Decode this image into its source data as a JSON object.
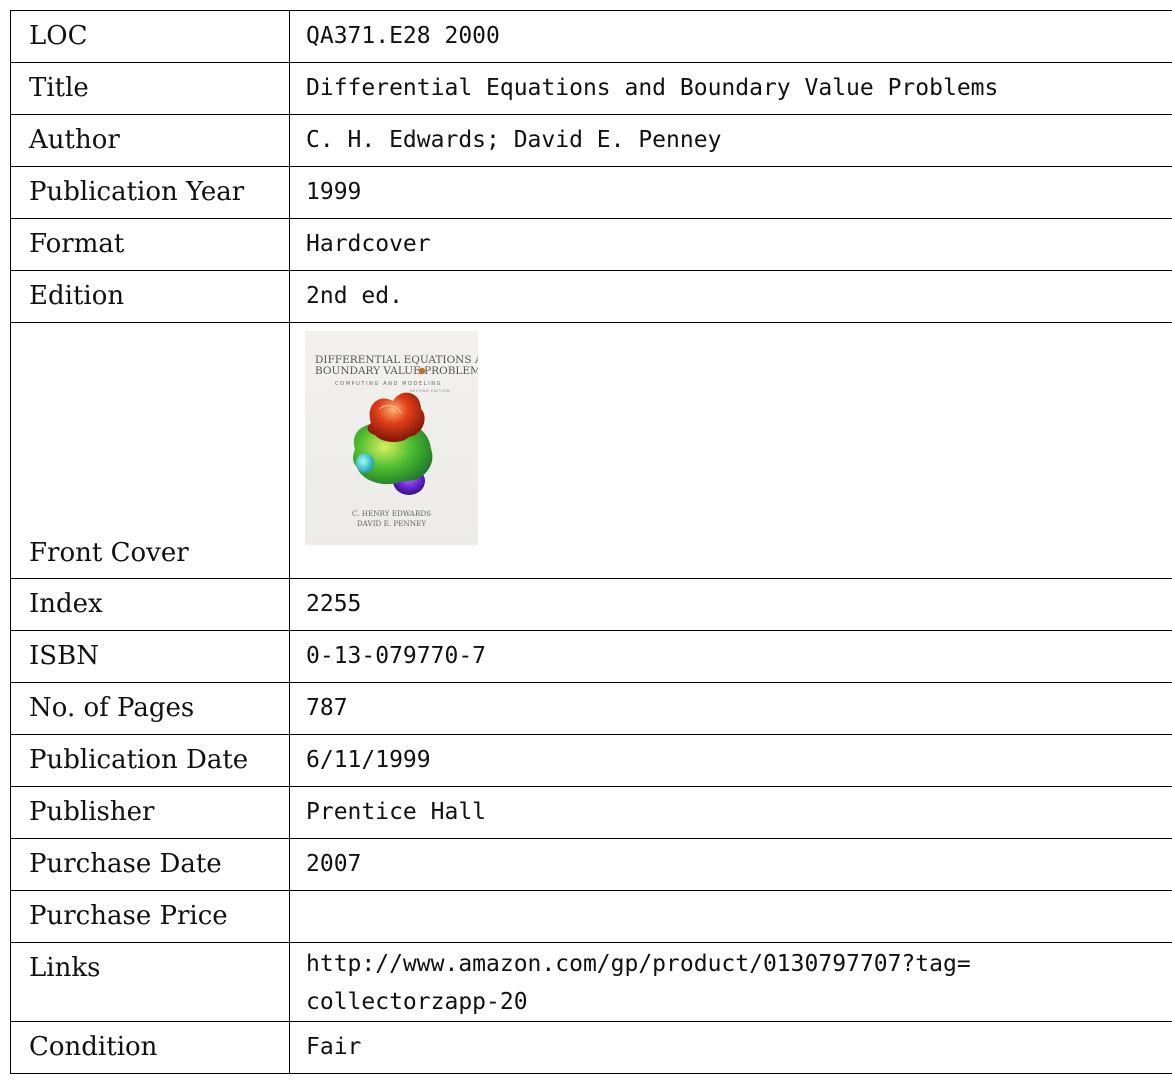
{
  "rows": {
    "loc": {
      "label": "LOC",
      "value": "QA371.E28 2000"
    },
    "title": {
      "label": "Title",
      "value": "Differential Equations and Boundary Value Problems"
    },
    "author": {
      "label": "Author",
      "value": "C. H. Edwards; David E. Penney"
    },
    "pub_year": {
      "label": "Publication Year",
      "value": "1999"
    },
    "format": {
      "label": "Format",
      "value": "Hardcover"
    },
    "edition": {
      "label": "Edition",
      "value": "2nd ed."
    },
    "front_cover": {
      "label": "Front Cover",
      "cover_title_line1": "DIFFERENTIAL EQUATIONS AND",
      "cover_title_line2": "BOUNDARY VALUE PROBLEMS",
      "cover_subtitle": "COMPUTING AND MODELING",
      "cover_edition": "SECOND EDITION",
      "cover_author1": "C. HENRY EDWARDS",
      "cover_author2": "DAVID E. PENNEY"
    },
    "index": {
      "label": "Index",
      "value": "2255"
    },
    "isbn": {
      "label": "ISBN",
      "value": "0-13-079770-7"
    },
    "pages": {
      "label": "No. of Pages",
      "value": "787"
    },
    "pub_date": {
      "label": "Publication Date",
      "value": "6/11/1999"
    },
    "publisher": {
      "label": "Publisher",
      "value": "Prentice Hall"
    },
    "purchase_date": {
      "label": "Purchase Date",
      "value": "2007"
    },
    "purchase_price": {
      "label": "Purchase Price",
      "value": ""
    },
    "links": {
      "label": "Links",
      "value_line1": "http://www.amazon.com/gp/product/0130797707?tag=",
      "value_line2": "collectorzapp-20"
    },
    "condition": {
      "label": "Condition",
      "value": "Fair"
    }
  }
}
